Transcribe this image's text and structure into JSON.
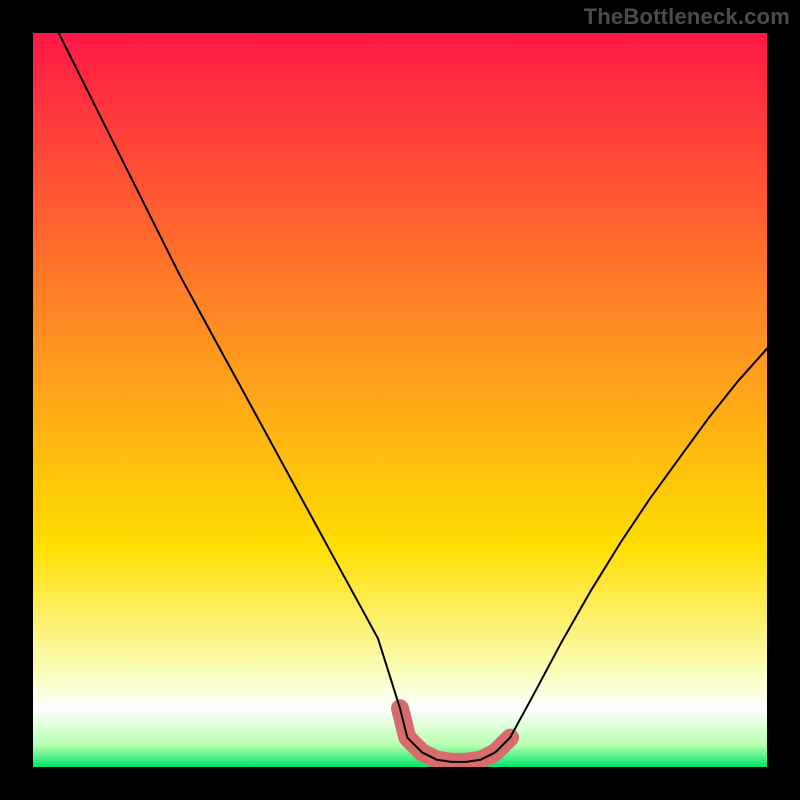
{
  "attribution": "TheBottleneck.com",
  "colors": {
    "top_red": "#ff1846",
    "warm_center": "#ffde00",
    "pale_yellow": "#fbffc6",
    "white_band": "#ffffff",
    "bottom_green": "#00e56a",
    "curve_stroke": "#000000",
    "highlight_stroke": "#d86c6c",
    "frame": "#000000"
  },
  "chart_data": {
    "type": "line",
    "title": "",
    "xlabel": "",
    "ylabel": "",
    "xlim": [
      0,
      100
    ],
    "ylim": [
      0,
      100
    ],
    "series": [
      {
        "name": "bottleneck-curve",
        "x": [
          0,
          2,
          5,
          8,
          11,
          14,
          17,
          20,
          23,
          26,
          29,
          32,
          35,
          38,
          41,
          44,
          47,
          50,
          51,
          53,
          55,
          57,
          59,
          61,
          63,
          65,
          68,
          72,
          76,
          80,
          84,
          88,
          92,
          96,
          100
        ],
        "y": [
          108,
          103,
          97,
          91,
          85,
          79,
          73,
          67,
          61.5,
          56,
          50.5,
          45,
          39.5,
          34,
          28.5,
          23,
          17.5,
          8,
          4,
          2,
          1,
          0.7,
          0.7,
          1,
          2,
          4,
          9.5,
          17,
          24,
          30.5,
          36.5,
          42,
          47.5,
          52.5,
          57
        ],
        "color": "#000000",
        "width": 2
      },
      {
        "name": "valley-highlight",
        "x": [
          50,
          51,
          53,
          55,
          57,
          59,
          61,
          63,
          65
        ],
        "y": [
          8,
          4,
          2,
          1,
          0.7,
          0.7,
          1,
          2,
          4
        ],
        "color": "#d86c6c",
        "width": 18
      }
    ],
    "gradient_bands": [
      {
        "y": 100,
        "color": "#ff1846"
      },
      {
        "y": 55,
        "color": "#ff9a1e"
      },
      {
        "y": 30,
        "color": "#ffde00"
      },
      {
        "y": 12,
        "color": "#fbffc6"
      },
      {
        "y": 8,
        "color": "#ffffff"
      },
      {
        "y": 3,
        "color": "#b8ffb0"
      },
      {
        "y": 0,
        "color": "#00e56a"
      }
    ]
  }
}
